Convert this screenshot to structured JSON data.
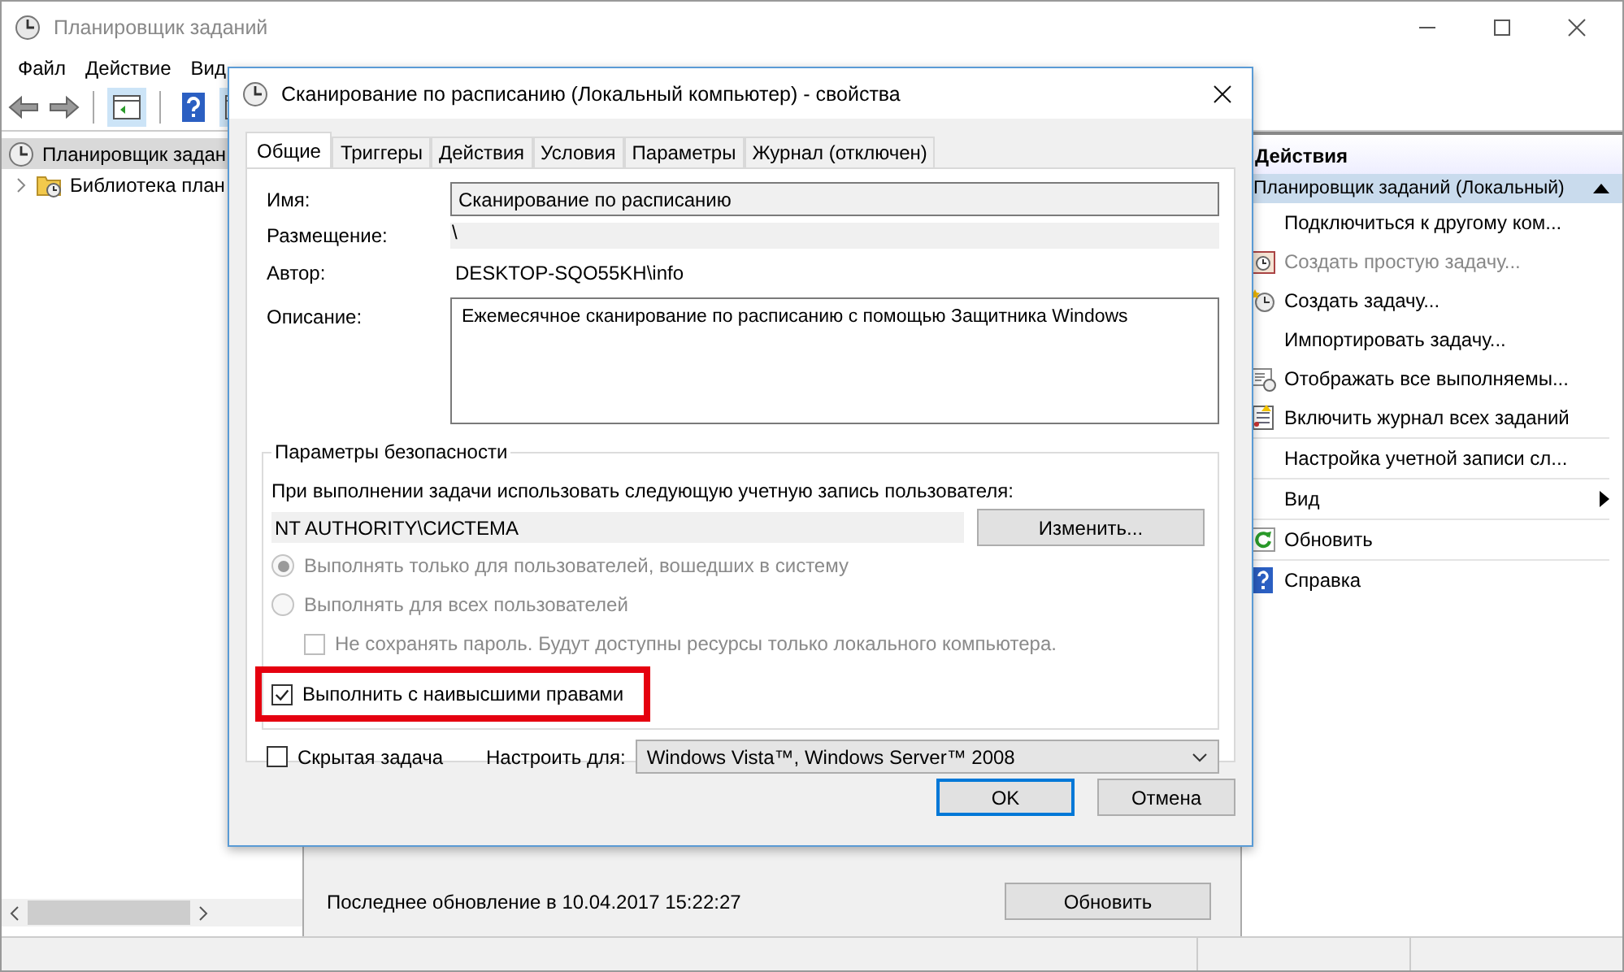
{
  "window": {
    "title": "Планировщик заданий"
  },
  "menu": [
    "Файл",
    "Действие",
    "Вид"
  ],
  "tree": [
    {
      "label": "Планировщик задан",
      "selected": true,
      "children": [
        {
          "label": "Библиотека план",
          "selected": false
        }
      ]
    }
  ],
  "summary": {
    "last_update": "Последнее обновление в 10.04.2017 15:22:27",
    "refresh_button": "Обновить"
  },
  "actions": {
    "title": "Действия",
    "group": "Планировщик заданий (Локальный)",
    "items": [
      {
        "label": "Подключиться к другому ком...",
        "disabled": false,
        "kind": "command",
        "separator_before": false
      },
      {
        "label": "Создать простую задачу...",
        "disabled": true,
        "kind": "command",
        "separator_before": false
      },
      {
        "label": "Создать задачу...",
        "disabled": false,
        "kind": "command",
        "separator_before": false
      },
      {
        "label": "Импортировать задачу...",
        "disabled": false,
        "kind": "command",
        "separator_before": false
      },
      {
        "label": "Отображать все выполняемы...",
        "disabled": false,
        "kind": "command",
        "separator_before": false
      },
      {
        "label": "Включить журнал всех заданий",
        "disabled": false,
        "kind": "command",
        "separator_before": false
      },
      {
        "label": "Настройка учетной записи сл...",
        "disabled": false,
        "kind": "command",
        "separator_before": true
      },
      {
        "label": "Вид",
        "disabled": false,
        "kind": "submenu",
        "separator_before": true
      },
      {
        "label": "Обновить",
        "disabled": false,
        "kind": "command",
        "separator_before": true
      },
      {
        "label": "Справка",
        "disabled": false,
        "kind": "command",
        "separator_before": true
      }
    ]
  },
  "dialog": {
    "title": "Сканирование по расписанию (Локальный компьютер) - свойства",
    "tabs": [
      {
        "label": "Общие",
        "selected": true
      },
      {
        "label": "Триггеры",
        "selected": false
      },
      {
        "label": "Действия",
        "selected": false
      },
      {
        "label": "Условия",
        "selected": false
      },
      {
        "label": "Параметры",
        "selected": false
      },
      {
        "label": "Журнал (отключен)",
        "selected": false
      }
    ],
    "fields": [
      {
        "label": "Имя:",
        "value": "Сканирование по расписанию",
        "kind": "input"
      },
      {
        "label": "Размещение:",
        "value": "\\",
        "kind": "readonly"
      },
      {
        "label": "Автор:",
        "value": "DESKTOP-SQO55KH\\info",
        "kind": "text"
      },
      {
        "label": "Описание:",
        "value": "Ежемесячное сканирование по расписанию с помощью Защитника Windows",
        "kind": "textarea"
      }
    ],
    "security": {
      "title": "Параметры безопасности",
      "prompt": "При выполнении задачи использовать следующую учетную запись пользователя:",
      "account": "NT AUTHORITY\\СИСТЕМА",
      "change_button": "Изменить...",
      "options": [
        {
          "label": "Выполнять только для пользователей, вошедших в систему",
          "selected": true,
          "disabled": true
        },
        {
          "label": "Выполнять для всех пользователей",
          "selected": false,
          "disabled": true,
          "children": [
            {
              "label": "Не сохранять пароль. Будут доступны ресурсы только локального компьютера.",
              "checked": false,
              "disabled": true
            }
          ]
        }
      ],
      "highest": {
        "label": "Выполнить с наивысшими правами",
        "checked": true,
        "highlighted": true
      }
    },
    "hidden": {
      "label": "Скрытая задача",
      "checked": false
    },
    "configure": {
      "label": "Настроить для:",
      "value": "Windows Vista™, Windows Server™ 2008"
    },
    "buttons": [
      {
        "label": "OK",
        "default": true
      },
      {
        "label": "Отмена",
        "default": false
      }
    ]
  }
}
